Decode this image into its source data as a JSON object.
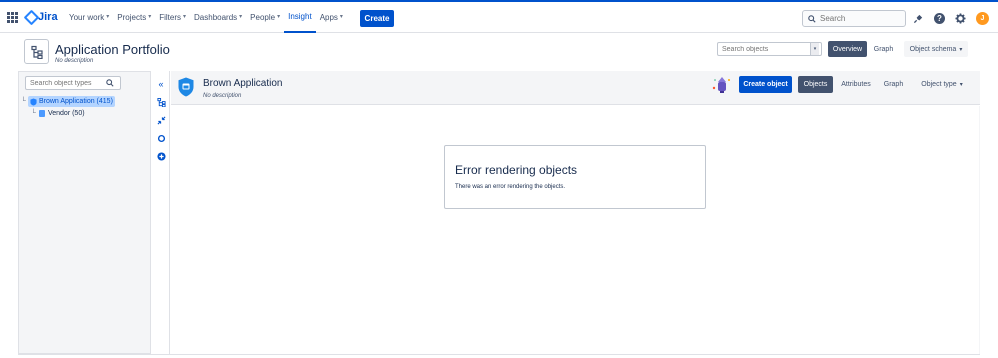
{
  "topnav": {
    "logo_text": "Jira",
    "items": [
      {
        "label": "Your work",
        "has_menu": true
      },
      {
        "label": "Projects",
        "has_menu": true
      },
      {
        "label": "Filters",
        "has_menu": true
      },
      {
        "label": "Dashboards",
        "has_menu": true
      },
      {
        "label": "People",
        "has_menu": true
      },
      {
        "label": "Insight",
        "has_menu": false,
        "active": true
      },
      {
        "label": "Apps",
        "has_menu": true
      }
    ],
    "create_label": "Create",
    "search_placeholder": "Search",
    "avatar_initial": "J",
    "icons": [
      "app-switcher-icon",
      "notifications-icon",
      "help-icon",
      "settings-icon"
    ]
  },
  "schema": {
    "title": "Application Portfolio",
    "description": "No description",
    "search_placeholder": "Search objects",
    "overview_label": "Overview",
    "graph_label": "Graph",
    "object_schema_label": "Object schema"
  },
  "tree": {
    "search_placeholder": "Search object types",
    "root": {
      "label": "Brown Application (415)"
    },
    "children": [
      {
        "label": "Vendor (50)"
      }
    ]
  },
  "object_type": {
    "title": "Brown Application",
    "description": "No description",
    "create_label": "Create object",
    "objects_label": "Objects",
    "attributes_label": "Attributes",
    "graph_label": "Graph",
    "object_type_label": "Object type"
  },
  "error": {
    "title": "Error rendering objects",
    "message": "There was an error rendering the objects."
  },
  "colors": {
    "brand": "#0052cc",
    "selected_dark": "#42526e",
    "avatar": "#ff991f",
    "tree_highlight": "#b3d4ff"
  }
}
